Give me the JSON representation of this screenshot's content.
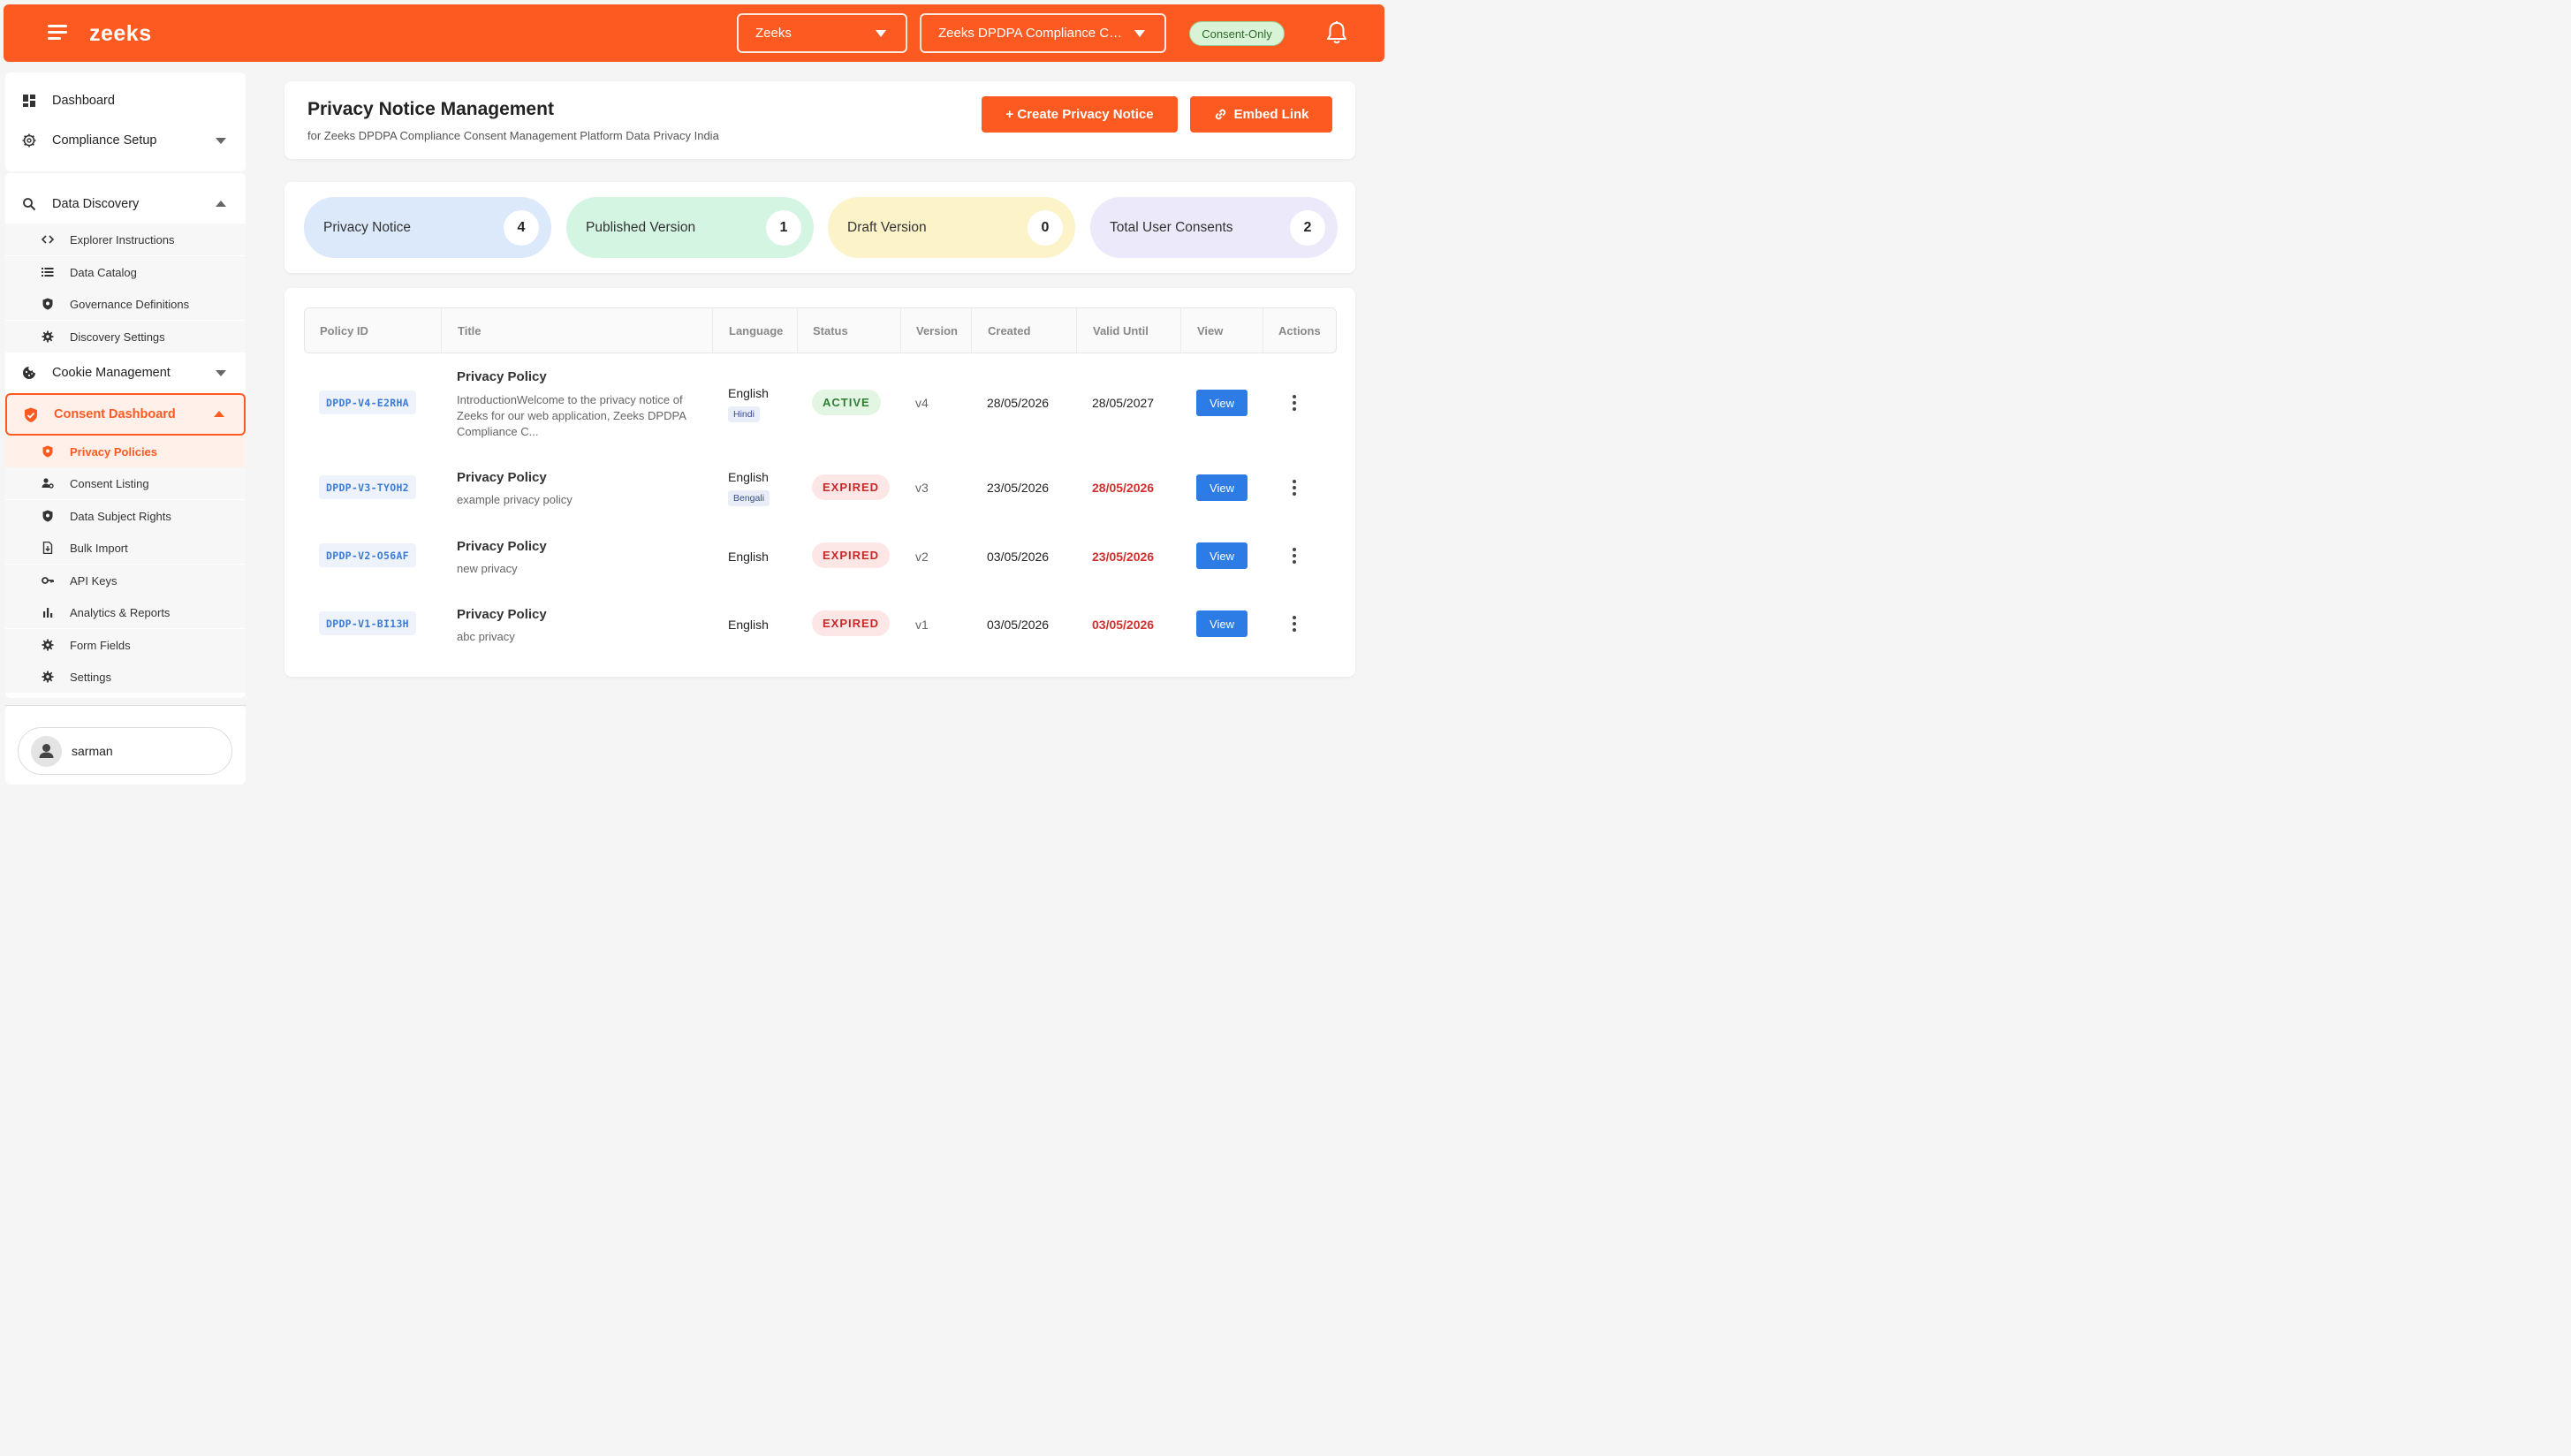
{
  "topbar": {
    "brand": "zeeks",
    "org_select": "Zeeks",
    "project_select": "Zeeks DPDPA Compliance Consent Management Platform Data Privacy India",
    "mode_badge": "Consent-Only"
  },
  "sidebar": {
    "dashboard": "Dashboard",
    "compliance_setup": "Compliance Setup",
    "data_discovery": "Data Discovery",
    "discovery_items": [
      "Explorer Instructions",
      "Data Catalog",
      "Governance Definitions",
      "Discovery Settings"
    ],
    "cookie_management": "Cookie Management",
    "consent_dashboard": "Consent Dashboard",
    "consent_items": [
      "Privacy Policies",
      "Consent Listing",
      "Data Subject Rights",
      "Bulk Import",
      "API Keys",
      "Analytics & Reports",
      "Form Fields",
      "Settings"
    ],
    "user_name": "sarman"
  },
  "header": {
    "title": "Privacy Notice Management",
    "subtitle": "for Zeeks DPDPA Compliance Consent Management Platform Data Privacy India",
    "create_button": "+ Create Privacy Notice",
    "embed_button": "Embed Link"
  },
  "stats": [
    {
      "label": "Privacy Notice",
      "value": "4",
      "color": "#dbe9fb"
    },
    {
      "label": "Published Version",
      "value": "1",
      "color": "#d5f5e3"
    },
    {
      "label": "Draft Version",
      "value": "0",
      "color": "#fdf3c9"
    },
    {
      "label": "Total User Consents",
      "value": "2",
      "color": "#ece9fb"
    }
  ],
  "table": {
    "headers": [
      "Policy ID",
      "Title",
      "Language",
      "Status",
      "Version",
      "Created",
      "Valid Until",
      "View",
      "Actions"
    ],
    "rows": [
      {
        "id": "DPDP-V4-E2RHA",
        "title": "Privacy Policy",
        "desc": "IntroductionWelcome to the privacy notice of Zeeks for our web application, Zeeks DPDPA Compliance C...",
        "language": "English",
        "extra_language": "Hindi",
        "status": "ACTIVE",
        "version": "v4",
        "created": "28/05/2026",
        "valid_until": "28/05/2027",
        "view": "View"
      },
      {
        "id": "DPDP-V3-TYOH2",
        "title": "Privacy Policy",
        "desc": "example privacy policy",
        "language": "English",
        "extra_language": "Bengali",
        "status": "EXPIRED",
        "version": "v3",
        "created": "23/05/2026",
        "valid_until": "28/05/2026",
        "view": "View"
      },
      {
        "id": "DPDP-V2-O56AF",
        "title": "Privacy Policy",
        "desc": "new privacy",
        "language": "English",
        "extra_language": "",
        "status": "EXPIRED",
        "version": "v2",
        "created": "03/05/2026",
        "valid_until": "23/05/2026",
        "view": "View"
      },
      {
        "id": "DPDP-V1-BI13H",
        "title": "Privacy Policy",
        "desc": "abc privacy",
        "language": "English",
        "extra_language": "",
        "status": "EXPIRED",
        "version": "v1",
        "created": "03/05/2026",
        "valid_until": "03/05/2026",
        "view": "View"
      }
    ]
  },
  "colors": {
    "accent": "#fd5a22",
    "view_button": "#2d7be5",
    "active": "#2f7d32",
    "expired": "#c62828"
  }
}
